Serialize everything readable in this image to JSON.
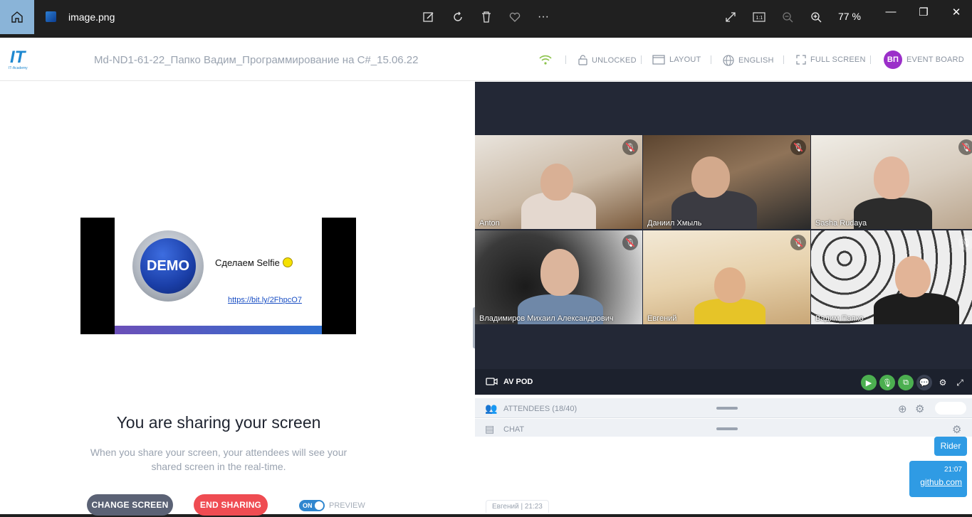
{
  "viewer": {
    "file_name": "image.png",
    "zoom": "77 %"
  },
  "header": {
    "meeting_title": "Md-ND1-61-22_Папко Вадим_Программирование на С#_15.06.22",
    "unlocked": "UNLOCKED",
    "layout": "LAYOUT",
    "language": "ENGLISH",
    "fullscreen": "FULL SCREEN",
    "avatar_initials": "ВП",
    "event_board": "EVENT BOARD",
    "logo_text": "IT",
    "logo_sub": "IT-Academy"
  },
  "share": {
    "slide_demo": "DEMO",
    "slide_text": "Сделаем Selfie",
    "slide_link": "https://bit.ly/2FhpcO7",
    "title": "You are sharing your screen",
    "description_line1": "When you share your screen, your attendees will see your",
    "description_line2": "shared screen in the real-time.",
    "change_screen": "CHANGE SCREEN",
    "end_sharing": "END SHARING",
    "toggle_state": "ON",
    "preview_label": "PREVIEW"
  },
  "video": {
    "tiles": [
      {
        "name": "Anton"
      },
      {
        "name": "Даниил Хмыль"
      },
      {
        "name": "Sasha Rudaya"
      },
      {
        "name": "Владимиров Михаил Александрович"
      },
      {
        "name": "Евгений"
      },
      {
        "name": "Вадим Папко"
      }
    ],
    "av_pod_label": "AV POD"
  },
  "pods": {
    "attendees_label": "ATTENDEES (18/40)",
    "chat_label": "CHAT"
  },
  "chat": {
    "msg1": "Rider",
    "msg2_time": "21:07",
    "msg2_link": "github.com",
    "last_sender": "Евгений",
    "last_time": "21:23"
  },
  "colors": {
    "accent_blue": "#2f86cf",
    "end_red": "#ef4c52",
    "green": "#4caf50",
    "dark_panel": "#232836",
    "avatar_purple": "#9b2fc9"
  }
}
